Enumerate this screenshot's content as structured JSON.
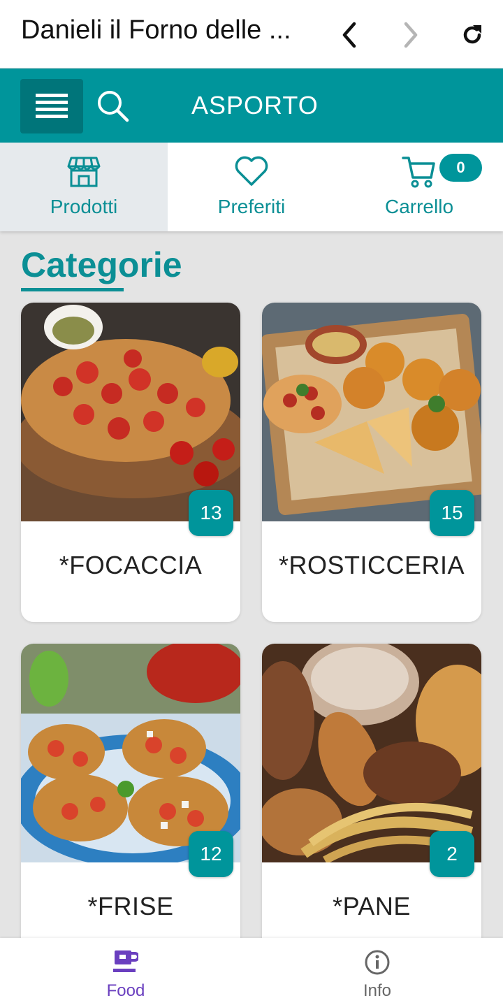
{
  "browser": {
    "title": "Danieli il Forno delle ...",
    "back_icon": "chevron-left-icon",
    "forward_icon": "chevron-right-icon",
    "reload_icon": "reload-icon"
  },
  "appbar": {
    "menu_icon": "hamburger-menu-icon",
    "search_icon": "search-icon",
    "mode_label": "ASPORTO",
    "color": "#00959b"
  },
  "tabs": [
    {
      "label": "Prodotti",
      "icon": "store-icon",
      "active": true
    },
    {
      "label": "Preferiti",
      "icon": "heart-icon",
      "active": false
    },
    {
      "label": "Carrello",
      "icon": "cart-icon",
      "active": false,
      "badge": "0"
    }
  ],
  "main": {
    "section_title": "Categorie",
    "categories": [
      {
        "name": "*FOCACCIA",
        "count": "13"
      },
      {
        "name": "*ROSTICCERIA",
        "count": "15"
      },
      {
        "name": "*FRISE",
        "count": "12"
      },
      {
        "name": "*PANE",
        "count": "2"
      }
    ]
  },
  "bottom_nav": [
    {
      "label": "Food",
      "icon": "coffee-cup-icon",
      "active": true,
      "color": "#6a3fbf"
    },
    {
      "label": "Info",
      "icon": "info-icon",
      "active": false,
      "color": "#666666"
    }
  ]
}
